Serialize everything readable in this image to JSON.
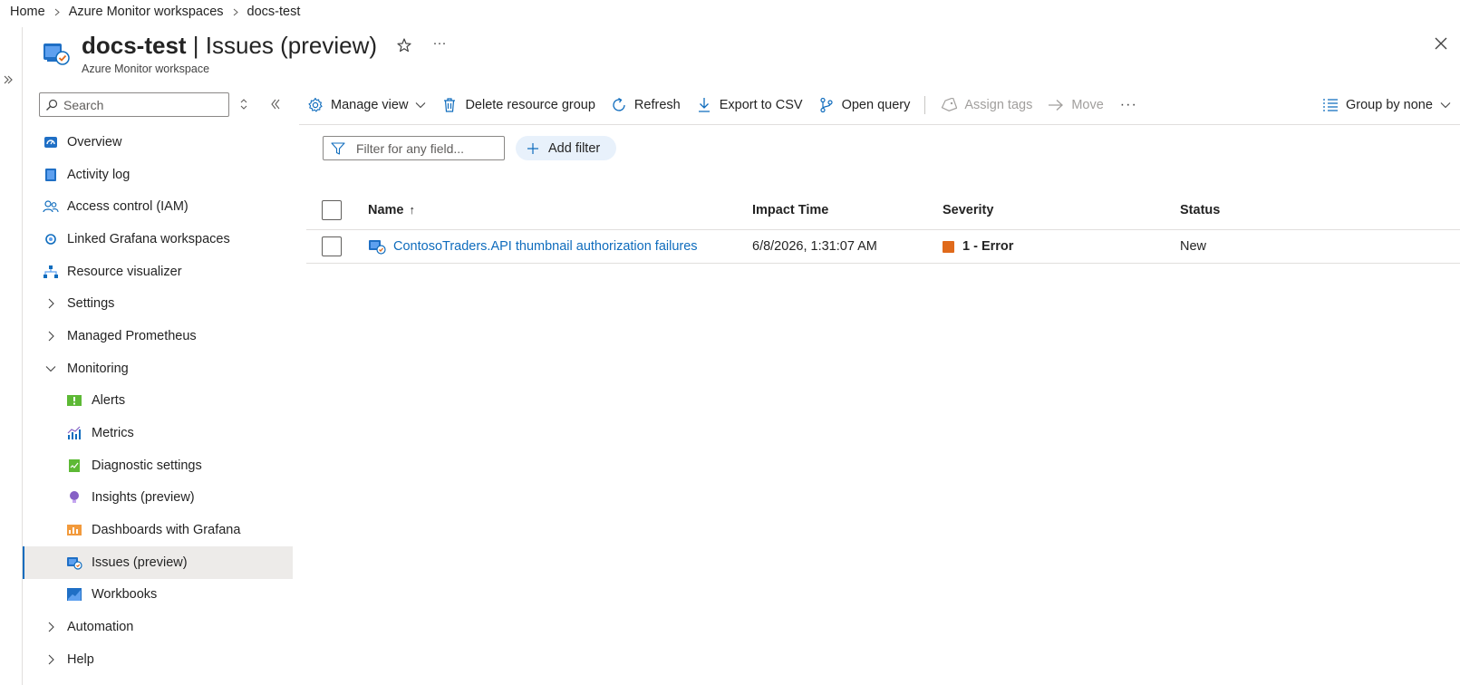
{
  "breadcrumb": {
    "items": [
      "Home",
      "Azure Monitor workspaces",
      "docs-test"
    ]
  },
  "header": {
    "resource_name": "docs-test",
    "separator": " | ",
    "page_name": "Issues (preview)",
    "subtitle": "Azure Monitor workspace",
    "icons": {
      "resource": "azure-monitor-workspace-icon",
      "favorite": "star-icon",
      "more": "ellipsis-icon",
      "close": "close-icon"
    }
  },
  "sidebar": {
    "search_placeholder": "Search",
    "items": [
      {
        "label": "Overview",
        "icon": "overview-icon"
      },
      {
        "label": "Activity log",
        "icon": "activity-log-icon"
      },
      {
        "label": "Access control (IAM)",
        "icon": "people-icon"
      },
      {
        "label": "Linked Grafana workspaces",
        "icon": "grafana-icon"
      },
      {
        "label": "Resource visualizer",
        "icon": "hierarchy-icon"
      },
      {
        "label": "Settings",
        "icon": "chevron-right-icon"
      },
      {
        "label": "Managed Prometheus",
        "icon": "chevron-right-icon"
      },
      {
        "label": "Monitoring",
        "icon": "chevron-down-icon"
      },
      {
        "label": "Alerts",
        "icon": "alerts-icon"
      },
      {
        "label": "Metrics",
        "icon": "metrics-icon"
      },
      {
        "label": "Diagnostic settings",
        "icon": "diagnostic-icon"
      },
      {
        "label": "Insights (preview)",
        "icon": "lightbulb-icon"
      },
      {
        "label": "Dashboards with Grafana",
        "icon": "dashboard-icon"
      },
      {
        "label": "Issues (preview)",
        "icon": "issues-icon"
      },
      {
        "label": "Workbooks",
        "icon": "workbooks-icon"
      },
      {
        "label": "Automation",
        "icon": "chevron-right-icon"
      },
      {
        "label": "Help",
        "icon": "chevron-right-icon"
      }
    ]
  },
  "toolbar": {
    "manage_view": "Manage view",
    "delete_resource_group": "Delete resource group",
    "refresh": "Refresh",
    "export_csv": "Export to CSV",
    "open_query": "Open query",
    "assign_tags": "Assign tags",
    "move": "Move",
    "more": "···",
    "group_by": "Group by none"
  },
  "filters": {
    "filter_placeholder": "Filter for any field...",
    "add_filter": "Add filter"
  },
  "table": {
    "columns": {
      "name": "Name",
      "impact_time": "Impact Time",
      "severity": "Severity",
      "status": "Status"
    },
    "sort_indicator": "↑",
    "rows": [
      {
        "name": "ContosoTraders.API thumbnail authorization failures",
        "impact_time": "6/8/2026, 1:31:07 AM",
        "severity": "1 - Error",
        "severity_color": "#e06a1b",
        "status": "New"
      }
    ]
  },
  "colors": {
    "accent": "#0f6cbd",
    "selected_nav_bg": "#edebe9"
  }
}
